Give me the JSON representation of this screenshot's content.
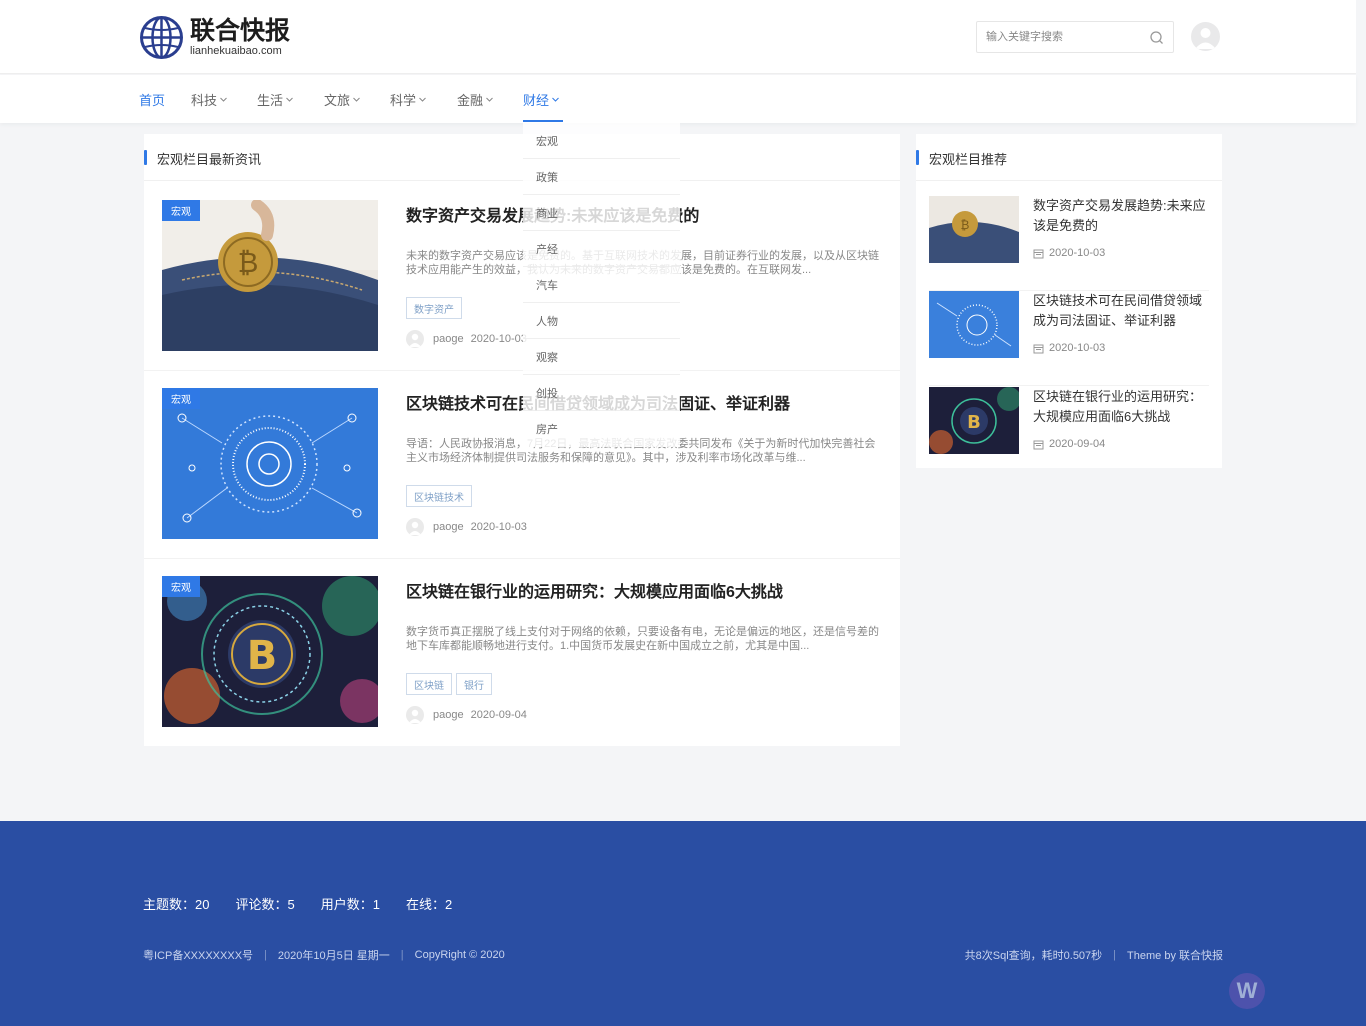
{
  "brand": {
    "name_cn": "联合快报",
    "name_en": "lianhekuaibao.com"
  },
  "search": {
    "placeholder": "输入关键字搜索"
  },
  "nav": {
    "items": [
      {
        "label": "首页"
      },
      {
        "label": "科技"
      },
      {
        "label": "生活"
      },
      {
        "label": "文旅"
      },
      {
        "label": "科学"
      },
      {
        "label": "金融"
      },
      {
        "label": "财经"
      }
    ]
  },
  "dropdown": {
    "items": [
      "宏观",
      "政策",
      "商业",
      "产经",
      "汽车",
      "人物",
      "观察",
      "创投",
      "房产"
    ]
  },
  "main": {
    "section_title": "宏观栏目最新资讯",
    "articles": [
      {
        "category": "宏观",
        "title": "数字资产交易发展趋势:未来应该是免费的",
        "excerpt": "未来的数字资产交易应该是免费的。基于互联网技术的发展，目前证券行业的发展，以及从区块链技术应用能产生的效益，我认为未来的数字资产交易都应该是免费的。在互联网发...",
        "tags": [
          "数字资产"
        ],
        "author": "paoge",
        "date": "2020-10-03"
      },
      {
        "category": "宏观",
        "title": "区块链技术可在民间借贷领域成为司法固证、举证利器",
        "excerpt": "导语：人民政协报消息，7月22日，最高法联合国家发改委共同发布《关于为新时代加快完善社会主义市场经济体制提供司法服务和保障的意见》。其中，涉及利率市场化改革与维...",
        "tags": [
          "区块链技术"
        ],
        "author": "paoge",
        "date": "2020-10-03"
      },
      {
        "category": "宏观",
        "title": "区块链在银行业的运用研究：大规模应用面临6大挑战",
        "excerpt": "数字货币真正摆脱了线上支付对于网络的依赖，只要设备有电，无论是偏远的地区，还是信号差的地下车库都能顺畅地进行支付。1.中国货币发展史在新中国成立之前，尤其是中国...",
        "tags": [
          "区块链",
          "银行"
        ],
        "author": "paoge",
        "date": "2020-09-04"
      }
    ]
  },
  "sidebar": {
    "title": "宏观栏目推荐",
    "items": [
      {
        "title": "数字资产交易发展趋势:未来应该是免费的",
        "date": "2020-10-03"
      },
      {
        "title": "区块链技术可在民间借贷领域成为司法固证、举证利器",
        "date": "2020-10-03"
      },
      {
        "title": "区块链在银行业的运用研究：大规模应用面临6大挑战",
        "date": "2020-09-04"
      }
    ]
  },
  "footer": {
    "stats": [
      "主题数：20",
      "评论数：5",
      "用户数：1",
      "在线：2"
    ],
    "icp": "粤ICP备XXXXXXXX号",
    "date": "2020年10月5日 星期一",
    "copyright": "CopyRight © 2020",
    "queries": "共8次Sql查询，耗时0.507秒",
    "theme": "Theme by 联合快报"
  },
  "colors": {
    "accent": "#2f79e6",
    "footer_bg": "#2a4ea3"
  }
}
